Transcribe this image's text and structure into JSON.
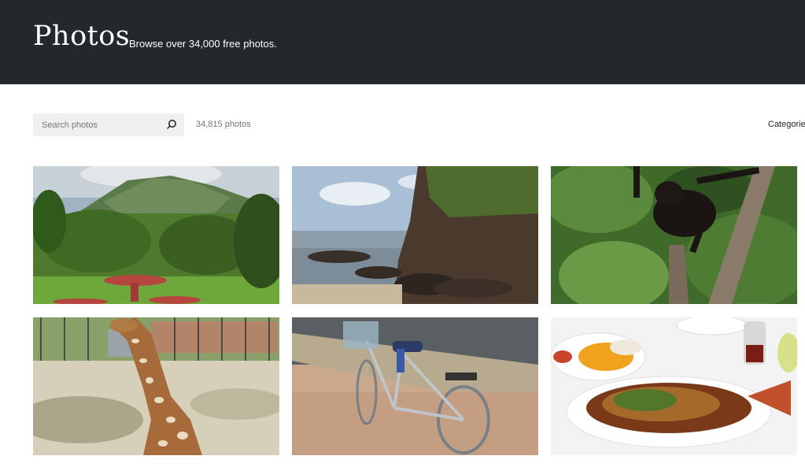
{
  "header": {
    "title": "Photos",
    "tagline": "Browse over 34,000 free photos."
  },
  "toolbar": {
    "search_placeholder": "Search photos",
    "search_value": "",
    "search_icon": "search-icon",
    "count_label": "34,815 photos",
    "categories_label": "Categories"
  },
  "photos": [
    {
      "subject": "volcano-landscape"
    },
    {
      "subject": "rocky-coastline"
    },
    {
      "subject": "monkey-in-tree"
    },
    {
      "subject": "giraffe-sitting"
    },
    {
      "subject": "bicycle"
    },
    {
      "subject": "fish-and-fries-plate"
    }
  ],
  "colors": {
    "header_bg": "#23282d",
    "search_bg": "#f0f0f1",
    "muted_text": "#757575"
  }
}
